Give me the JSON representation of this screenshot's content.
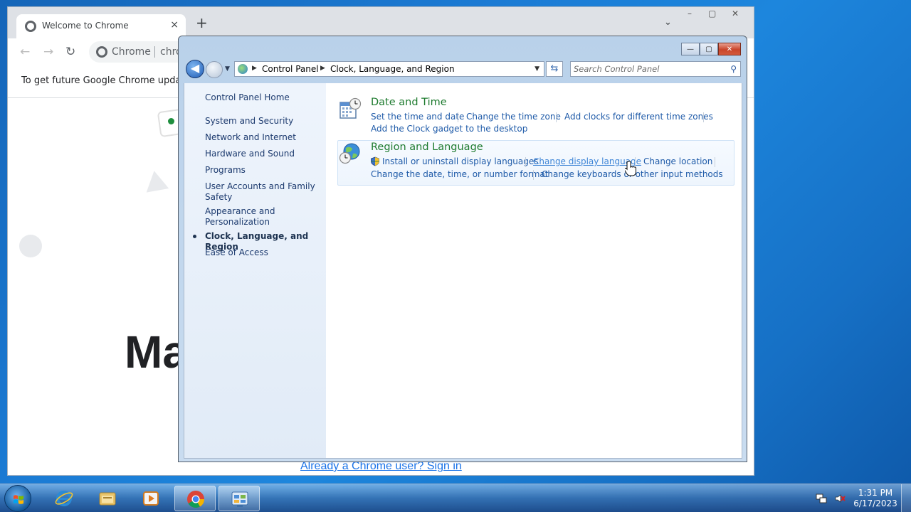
{
  "chrome": {
    "tab_title": "Welcome to Chrome",
    "tab_close": "×",
    "new_tab": "+",
    "tab_menu": "⌄",
    "win_min": "–",
    "win_max": "▢",
    "win_close": "✕",
    "back": "←",
    "forward": "→",
    "reload": "↻",
    "omnibox_label": "Chrome",
    "omnibox_url": "chro",
    "infobar_text": "To get future Google Chrome updates,",
    "heading_partial": "Ma",
    "signin_link": "Already a Chrome user? Sign in"
  },
  "control_panel": {
    "caption": {
      "minimize": "—",
      "maximize": "▢",
      "close": "✕"
    },
    "nav": {
      "back": "◀",
      "dropdown": "▼"
    },
    "address": {
      "crumbs": [
        "Control Panel",
        "Clock, Language, and Region"
      ],
      "arrow": "▶",
      "dropdown": "▼"
    },
    "refresh": "⇆",
    "search": {
      "placeholder": "Search Control Panel",
      "value": "",
      "icon": "⚲"
    },
    "sidebar": {
      "home": "Control Panel Home",
      "items": [
        {
          "label": "System and Security"
        },
        {
          "label": "Network and Internet"
        },
        {
          "label": "Hardware and Sound"
        },
        {
          "label": "Programs"
        },
        {
          "label": "User Accounts and Family Safety"
        },
        {
          "label": "Appearance and Personalization"
        },
        {
          "label": "Clock, Language, and Region",
          "current": true
        },
        {
          "label": "Ease of Access"
        }
      ]
    },
    "categories": [
      {
        "title": "Date and Time",
        "icon": "calendar-clock-icon",
        "tasks": [
          "Set the time and date",
          "Change the time zone",
          "Add clocks for different time zones",
          "Add the Clock gadget to the desktop"
        ]
      },
      {
        "title": "Region and Language",
        "icon": "globe-clock-icon",
        "tasks": [
          "Install or uninstall display languages",
          "Change display language",
          "Change location",
          "Change the date, time, or number format",
          "Change keyboards or other input methods"
        ]
      }
    ]
  },
  "taskbar": {
    "pinned": [
      "internet-explorer-icon",
      "windows-explorer-icon",
      "media-player-icon",
      "chrome-icon",
      "control-panel-icon"
    ],
    "clock_time": "1:31 PM",
    "clock_date": "6/17/2023"
  }
}
